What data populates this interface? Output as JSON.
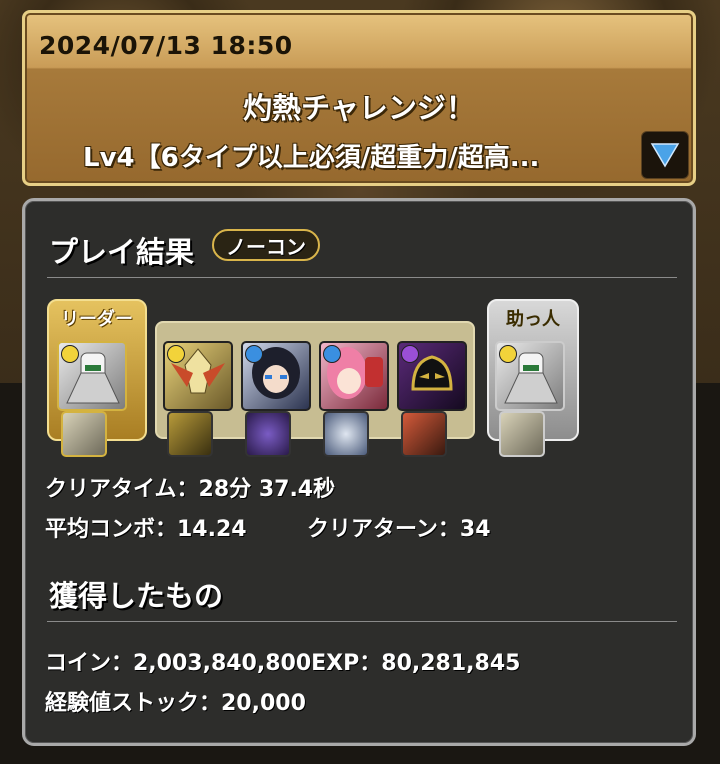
{
  "header": {
    "date": "2024/07/13 18:50",
    "title": "灼熱チャレンジ！",
    "subtitle": "Lv4【6タイプ以上必須/超重力/超高..."
  },
  "result": {
    "heading": "プレイ結果",
    "badge": "ノーコン",
    "leader_label": "リーダー",
    "helper_label": "助っ人",
    "team": [
      {
        "name": "leader-card",
        "icon": "white-mech-icon",
        "attribute": "light"
      },
      {
        "name": "member-card-1",
        "icon": "gold-mech-icon",
        "attribute": "light"
      },
      {
        "name": "member-card-2",
        "icon": "dark-haired-girl-icon",
        "attribute": "water"
      },
      {
        "name": "member-card-3",
        "icon": "pink-haired-girl-icon",
        "attribute": "water"
      },
      {
        "name": "member-card-4",
        "icon": "black-gold-mask-icon",
        "attribute": "dark"
      },
      {
        "name": "helper-card",
        "icon": "white-mech-icon",
        "attribute": "light"
      }
    ],
    "clear_time": "クリアタイム：28分 37.4秒",
    "avg_combo": "平均コンボ：14.24",
    "clear_turns": "クリアターン：34"
  },
  "rewards": {
    "heading": "獲得したもの",
    "coins": "コイン：2,003,840,800",
    "exp": "EXP：80,281,845",
    "exp_stock": "経験値ストック：20,000"
  },
  "colors": {
    "light": "#f2d33a",
    "water": "#3a8fe0",
    "dark": "#9a4fd6",
    "fire": "#d8402a"
  }
}
